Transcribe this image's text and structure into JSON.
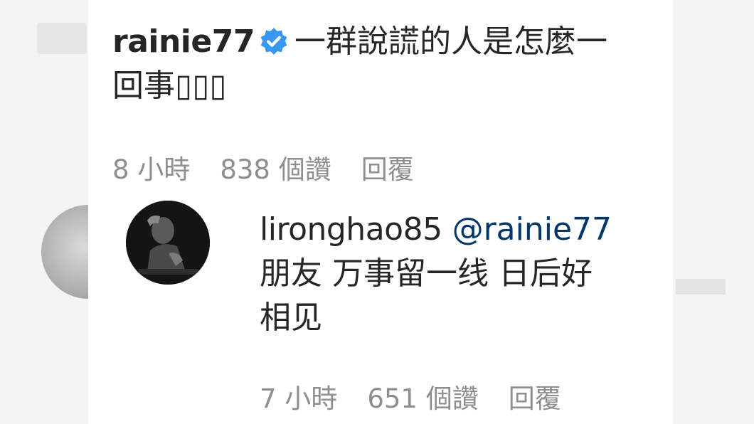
{
  "comment": {
    "username": "rainie77",
    "text_line1": "一群說謊的人是怎麼一",
    "text_line2": "回事▯▯▯",
    "meta": {
      "time": "8 小時",
      "likes": "838 個讚",
      "reply": "回覆"
    }
  },
  "reply": {
    "username": "lironghao85",
    "mention": "@rainie77",
    "text_line1": "朋友 万事留一线 日后好",
    "text_line2": "相见",
    "meta": {
      "time": "7 小時",
      "likes": "651 個讚",
      "reply": "回覆"
    }
  },
  "colors": {
    "text": "#262626",
    "meta": "#8e8e8e",
    "mention": "#00376b",
    "verified": "#3897f0"
  },
  "icons": {
    "verified": "verified-badge-icon",
    "avatar": "avatar"
  }
}
